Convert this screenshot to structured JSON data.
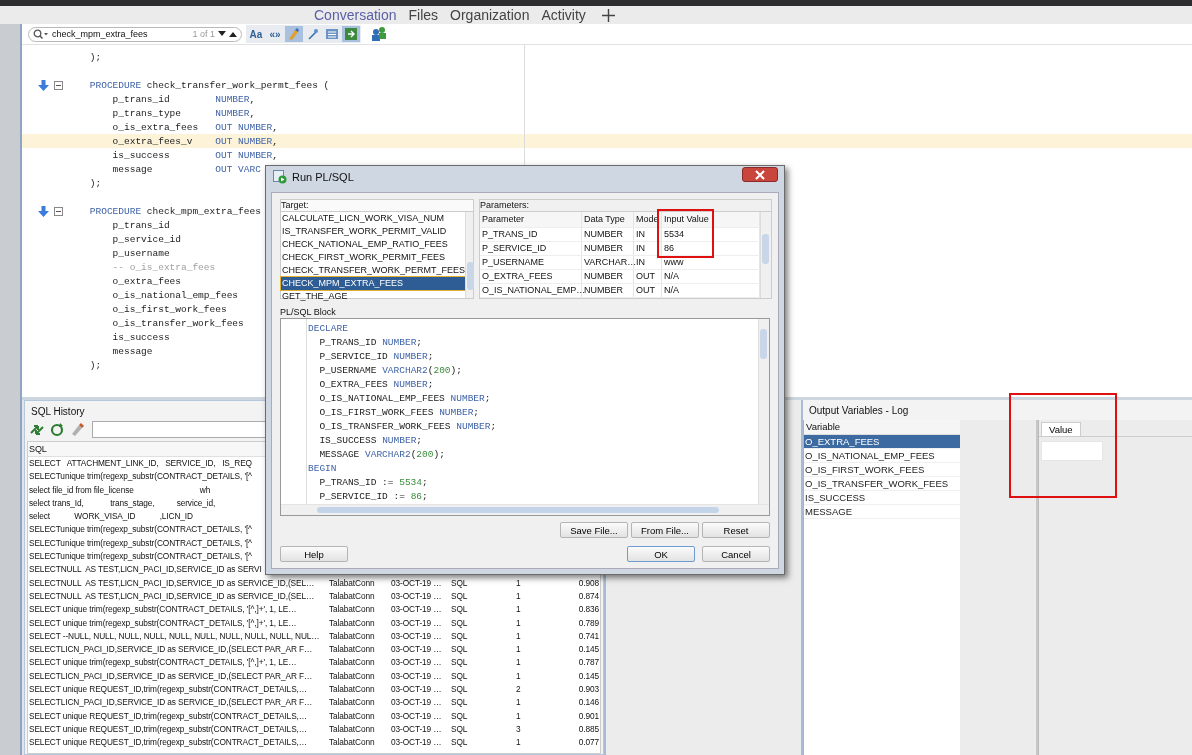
{
  "app_tabs": [
    {
      "label": "Conversation",
      "selected": true
    },
    {
      "label": "Files",
      "selected": false
    },
    {
      "label": "Organization",
      "selected": false
    },
    {
      "label": "Activity",
      "selected": false
    }
  ],
  "find_bar": {
    "value": "check_mpm_extra_fees",
    "match_count": "1 of 1",
    "options": [
      {
        "kind": "text",
        "label": "Aa",
        "selected": false
      },
      {
        "kind": "text",
        "label": "«»",
        "selected": false
      },
      {
        "kind": "brush",
        "selected": true
      },
      {
        "kind": "wand",
        "selected": false
      },
      {
        "kind": "list",
        "selected": false
      },
      {
        "kind": "export",
        "selected": true
      }
    ]
  },
  "editor": {
    "lines": [
      {
        "kind": "code",
        "bookmark": false,
        "highlighted": false,
        "parts": [
          {
            "kind": "plain",
            "text": "    );"
          }
        ]
      },
      {
        "kind": "blank"
      },
      {
        "kind": "code",
        "bookmark": true,
        "highlighted": false,
        "parts": [
          {
            "kind": "kw",
            "text": "    PROCEDURE"
          },
          {
            "kind": "plain",
            "text": " check_transfer_work_permt_fees ("
          }
        ]
      },
      {
        "kind": "code",
        "bookmark": false,
        "highlighted": false,
        "parts": [
          {
            "kind": "plain",
            "text": "        p_trans_id        "
          },
          {
            "kind": "kw",
            "text": "NUMBER"
          },
          {
            "kind": "plain",
            "text": ","
          }
        ]
      },
      {
        "kind": "code",
        "bookmark": false,
        "highlighted": false,
        "parts": [
          {
            "kind": "plain",
            "text": "        p_trans_type      "
          },
          {
            "kind": "kw",
            "text": "NUMBER"
          },
          {
            "kind": "plain",
            "text": ","
          }
        ]
      },
      {
        "kind": "code",
        "bookmark": false,
        "highlighted": false,
        "parts": [
          {
            "kind": "plain",
            "text": "        o_is_extra_fees   "
          },
          {
            "kind": "kw",
            "text": "OUT NUMBER"
          },
          {
            "kind": "plain",
            "text": ","
          }
        ]
      },
      {
        "kind": "code",
        "bookmark": false,
        "highlighted": true,
        "parts": [
          {
            "kind": "plain",
            "text": "        o_extra_fees_v    "
          },
          {
            "kind": "kw",
            "text": "OUT NUMBER"
          },
          {
            "kind": "plain",
            "text": ","
          }
        ]
      },
      {
        "kind": "code",
        "bookmark": false,
        "highlighted": false,
        "parts": [
          {
            "kind": "plain",
            "text": "        is_success        "
          },
          {
            "kind": "kw",
            "text": "OUT NUMBER"
          },
          {
            "kind": "plain",
            "text": ","
          }
        ]
      },
      {
        "kind": "code",
        "bookmark": false,
        "highlighted": false,
        "parts": [
          {
            "kind": "plain",
            "text": "        message           "
          },
          {
            "kind": "kw",
            "text": "OUT VARC"
          }
        ]
      },
      {
        "kind": "code",
        "bookmark": false,
        "highlighted": false,
        "parts": [
          {
            "kind": "plain",
            "text": "    );"
          }
        ]
      },
      {
        "kind": "blank"
      },
      {
        "kind": "code",
        "bookmark": true,
        "highlighted": false,
        "parts": [
          {
            "kind": "kw",
            "text": "    PROCEDURE"
          },
          {
            "kind": "plain",
            "text": " check_mpm_extra_fees"
          }
        ]
      },
      {
        "kind": "code",
        "bookmark": false,
        "highlighted": false,
        "parts": [
          {
            "kind": "plain",
            "text": "        p_trans_id"
          }
        ]
      },
      {
        "kind": "code",
        "bookmark": false,
        "highlighted": false,
        "parts": [
          {
            "kind": "plain",
            "text": "        p_service_id"
          }
        ]
      },
      {
        "kind": "code",
        "bookmark": false,
        "highlighted": false,
        "parts": [
          {
            "kind": "plain",
            "text": "        p_username"
          }
        ]
      },
      {
        "kind": "code",
        "bookmark": false,
        "highlighted": false,
        "parts": [
          {
            "kind": "comment",
            "text": "        -- o_is_extra_fees"
          }
        ]
      },
      {
        "kind": "code",
        "bookmark": false,
        "highlighted": false,
        "parts": [
          {
            "kind": "plain",
            "text": "        o_extra_fees"
          }
        ]
      },
      {
        "kind": "code",
        "bookmark": false,
        "highlighted": false,
        "parts": [
          {
            "kind": "plain",
            "text": "        o_is_national_emp_fees"
          }
        ]
      },
      {
        "kind": "code",
        "bookmark": false,
        "highlighted": false,
        "parts": [
          {
            "kind": "plain",
            "text": "        o_is_first_work_fees"
          }
        ]
      },
      {
        "kind": "code",
        "bookmark": false,
        "highlighted": false,
        "parts": [
          {
            "kind": "plain",
            "text": "        o_is_transfer_work_fees"
          }
        ]
      },
      {
        "kind": "code",
        "bookmark": false,
        "highlighted": false,
        "parts": [
          {
            "kind": "plain",
            "text": "        is_success"
          }
        ]
      },
      {
        "kind": "code",
        "bookmark": false,
        "highlighted": false,
        "parts": [
          {
            "kind": "plain",
            "text": "        message"
          }
        ]
      },
      {
        "kind": "code",
        "bookmark": false,
        "highlighted": false,
        "parts": [
          {
            "kind": "plain",
            "text": "    );"
          }
        ]
      }
    ]
  },
  "sql_history": {
    "title": "SQL History",
    "columns": [
      "SQL"
    ],
    "rows": [
      {
        "cells": [
          "SELECT   ATTACHMENT_LINK_ID,   SERVICE_ID,   IS_REQ"
        ]
      },
      {
        "cells": [
          "SELECTunique trim(regexp_substr(CONTRACT_DETAILS, '[^"
        ]
      },
      {
        "cells": [
          "select file_id from file_license                              wh"
        ]
      },
      {
        "cells": [
          "select trans_Id,            trans_stage,          service_id,"
        ]
      },
      {
        "cells": [
          "select           WORK_VISA_ID           ,LICN_ID"
        ]
      },
      {
        "cells": [
          "SELECTunique trim(regexp_substr(CONTRACT_DETAILS, '[^"
        ]
      },
      {
        "cells": [
          "SELECTunique trim(regexp_substr(CONTRACT_DETAILS, '[^"
        ]
      },
      {
        "cells": [
          "SELECTunique trim(regexp_substr(CONTRACT_DETAILS, '[^"
        ]
      },
      {
        "cells": [
          "SELECTNULL  AS TEST,LICN_PACI_ID,SERVICE_ID as SERVI"
        ]
      },
      {
        "cells": [
          "SELECTNULL  AS TEST,LICN_PACI_ID,SERVICE_ID as SERVICE_ID,(SEL…",
          "TalabatConn",
          "03-OCT-19 …",
          "SQL",
          "1",
          "0.908"
        ]
      },
      {
        "cells": [
          "SELECTNULL  AS TEST,LICN_PACI_ID,SERVICE_ID as SERVICE_ID,(SEL…",
          "TalabatConn",
          "03-OCT-19 …",
          "SQL",
          "1",
          "0.874"
        ]
      },
      {
        "cells": [
          "SELECT unique trim(regexp_substr(CONTRACT_DETAILS, '[^,]+', 1, LE…",
          "TalabatConn",
          "03-OCT-19 …",
          "SQL",
          "1",
          "0.836"
        ]
      },
      {
        "cells": [
          "SELECT unique trim(regexp_substr(CONTRACT_DETAILS, '[^,]+', 1, LE…",
          "TalabatConn",
          "03-OCT-19 …",
          "SQL",
          "1",
          "0.789"
        ]
      },
      {
        "cells": [
          "SELECT --NULL, NULL, NULL, NULL, NULL, NULL, NULL, NULL, NULL, NUL…",
          "TalabatConn",
          "03-OCT-19 …",
          "SQL",
          "1",
          "0.741"
        ]
      },
      {
        "cells": [
          "SELECTLICN_PACI_ID,SERVICE_ID as SERVICE_ID,(SELECT PAR_AR F…",
          "TalabatConn",
          "03-OCT-19 …",
          "SQL",
          "1",
          "0.145"
        ]
      },
      {
        "cells": [
          "SELECT unique trim(regexp_substr(CONTRACT_DETAILS, '[^,]+', 1, LE…",
          "TalabatConn",
          "03-OCT-19 …",
          "SQL",
          "1",
          "0.787"
        ]
      },
      {
        "cells": [
          "SELECTLICN_PACI_ID,SERVICE_ID as SERVICE_ID,(SELECT PAR_AR F…",
          "TalabatConn",
          "03-OCT-19 …",
          "SQL",
          "1",
          "0.145"
        ]
      },
      {
        "cells": [
          "SELECT unique REQUEST_ID,trim(regexp_substr(CONTRACT_DETAILS,…",
          "TalabatConn",
          "03-OCT-19 …",
          "SQL",
          "2",
          "0.903"
        ]
      },
      {
        "cells": [
          "SELECTLICN_PACI_ID,SERVICE_ID as SERVICE_ID,(SELECT PAR_AR F…",
          "TalabatConn",
          "03-OCT-19 …",
          "SQL",
          "1",
          "0.146"
        ]
      },
      {
        "cells": [
          "SELECT unique REQUEST_ID,trim(regexp_substr(CONTRACT_DETAILS,…",
          "TalabatConn",
          "03-OCT-19 …",
          "SQL",
          "1",
          "0.901"
        ]
      },
      {
        "cells": [
          "SELECT unique REQUEST_ID,trim(regexp_substr(CONTRACT_DETAILS,…",
          "TalabatConn",
          "03-OCT-19 …",
          "SQL",
          "3",
          "0.885"
        ]
      },
      {
        "cells": [
          "SELECT unique REQUEST_ID,trim(regexp_substr(CONTRACT_DETAILS,…",
          "TalabatConn",
          "03-OCT-19 …",
          "SQL",
          "1",
          "0.077"
        ]
      }
    ]
  },
  "output": {
    "title": "Output Variables - Log",
    "variable_column": "Variable",
    "variables": [
      {
        "name": "O_EXTRA_FEES",
        "selected": true
      },
      {
        "name": "O_IS_NATIONAL_EMP_FEES",
        "selected": false
      },
      {
        "name": "O_IS_FIRST_WORK_FEES",
        "selected": false
      },
      {
        "name": "O_IS_TRANSFER_WORK_FEES",
        "selected": false
      },
      {
        "name": "IS_SUCCESS",
        "selected": false
      },
      {
        "name": "MESSAGE",
        "selected": false
      }
    ],
    "value_tab": "Value"
  },
  "dialog": {
    "title": "Run PL/SQL",
    "target_label": "Target:",
    "targets": [
      {
        "name": "CALCULATE_LICN_WORK_VISA_NUM",
        "selected": false
      },
      {
        "name": "IS_TRANSFER_WORK_PERMIT_VALID",
        "selected": false
      },
      {
        "name": "CHECK_NATIONAL_EMP_RATIO_FEES",
        "selected": false
      },
      {
        "name": "CHECK_FIRST_WORK_PERMIT_FEES",
        "selected": false
      },
      {
        "name": "CHECK_TRANSFER_WORK_PERMT_FEES",
        "selected": false
      },
      {
        "name": "CHECK_MPM_EXTRA_FEES",
        "selected": true
      },
      {
        "name": "GET_THE_AGE",
        "selected": false
      }
    ],
    "parameters_label": "Parameters:",
    "parameter_columns": [
      "Parameter",
      "Data Type",
      "Mode",
      "Input Value"
    ],
    "parameters": [
      [
        "P_TRANS_ID",
        "NUMBER",
        "IN",
        "5534"
      ],
      [
        "P_SERVICE_ID",
        "NUMBER",
        "IN",
        "86"
      ],
      [
        "P_USERNAME",
        "VARCHAR…",
        "IN",
        "www"
      ],
      [
        "O_EXTRA_FEES",
        "NUMBER",
        "OUT",
        "N/A"
      ],
      [
        "O_IS_NATIONAL_EMP…",
        "NUMBER",
        "OUT",
        "N/A"
      ]
    ],
    "block_label": "PL/SQL Block",
    "block_lines": [
      [
        {
          "kind": "kw",
          "text": "DECLARE"
        }
      ],
      [
        {
          "kind": "plain",
          "text": "  P_TRANS_ID "
        },
        {
          "kind": "kw",
          "text": "NUMBER"
        },
        {
          "kind": "plain",
          "text": ";"
        }
      ],
      [
        {
          "kind": "plain",
          "text": "  P_SERVICE_ID "
        },
        {
          "kind": "kw",
          "text": "NUMBER"
        },
        {
          "kind": "plain",
          "text": ";"
        }
      ],
      [
        {
          "kind": "plain",
          "text": "  P_USERNAME "
        },
        {
          "kind": "kw",
          "text": "VARCHAR2"
        },
        {
          "kind": "plain",
          "text": "("
        },
        {
          "kind": "num",
          "text": "200"
        },
        {
          "kind": "plain",
          "text": ");"
        }
      ],
      [
        {
          "kind": "plain",
          "text": "  O_EXTRA_FEES "
        },
        {
          "kind": "kw",
          "text": "NUMBER"
        },
        {
          "kind": "plain",
          "text": ";"
        }
      ],
      [
        {
          "kind": "plain",
          "text": "  O_IS_NATIONAL_EMP_FEES "
        },
        {
          "kind": "kw",
          "text": "NUMBER"
        },
        {
          "kind": "plain",
          "text": ";"
        }
      ],
      [
        {
          "kind": "plain",
          "text": "  O_IS_FIRST_WORK_FEES "
        },
        {
          "kind": "kw",
          "text": "NUMBER"
        },
        {
          "kind": "plain",
          "text": ";"
        }
      ],
      [
        {
          "kind": "plain",
          "text": "  O_IS_TRANSFER_WORK_FEES "
        },
        {
          "kind": "kw",
          "text": "NUMBER"
        },
        {
          "kind": "plain",
          "text": ";"
        }
      ],
      [
        {
          "kind": "plain",
          "text": "  IS_SUCCESS "
        },
        {
          "kind": "kw",
          "text": "NUMBER"
        },
        {
          "kind": "plain",
          "text": ";"
        }
      ],
      [
        {
          "kind": "plain",
          "text": "  MESSAGE "
        },
        {
          "kind": "kw",
          "text": "VARCHAR2"
        },
        {
          "kind": "plain",
          "text": "("
        },
        {
          "kind": "num",
          "text": "200"
        },
        {
          "kind": "plain",
          "text": ");"
        }
      ],
      [
        {
          "kind": "kw",
          "text": "BEGIN"
        }
      ],
      [
        {
          "kind": "plain",
          "text": "  P_TRANS_ID := "
        },
        {
          "kind": "num",
          "text": "5534"
        },
        {
          "kind": "plain",
          "text": ";"
        }
      ],
      [
        {
          "kind": "plain",
          "text": "  P_SERVICE_ID := "
        },
        {
          "kind": "num",
          "text": "86"
        },
        {
          "kind": "plain",
          "text": ";"
        }
      ]
    ],
    "file_buttons": [
      "Save File...",
      "From File...",
      "Reset"
    ],
    "help_button": "Help",
    "ok_button": "OK",
    "cancel_button": "Cancel"
  }
}
